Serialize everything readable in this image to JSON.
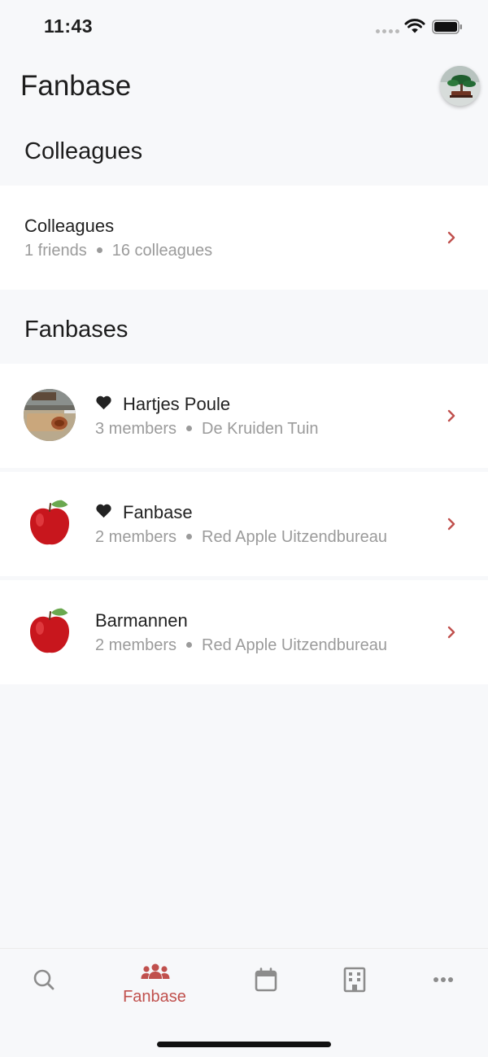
{
  "status_bar": {
    "time": "11:43"
  },
  "header": {
    "title": "Fanbase"
  },
  "colleagues_section": {
    "heading": "Colleagues",
    "item": {
      "title": "Colleagues",
      "friends": "1 friends",
      "colleagues": "16 colleagues"
    }
  },
  "fanbases_section": {
    "heading": "Fanbases",
    "items": [
      {
        "title": "Hartjes Poule",
        "members": "3 members",
        "organization": "De Kruiden Tuin",
        "favorite": true,
        "image": "kitchen-photo"
      },
      {
        "title": "Fanbase",
        "members": "2 members",
        "organization": "Red Apple Uitzendbureau",
        "favorite": true,
        "image": "red-apple-logo"
      },
      {
        "title": "Barmannen",
        "members": "2 members",
        "organization": "Red Apple Uitzendbureau",
        "favorite": false,
        "image": "red-apple-logo"
      }
    ]
  },
  "tab_bar": {
    "tabs": [
      {
        "icon": "search-icon",
        "label": ""
      },
      {
        "icon": "group-icon",
        "label": "Fanbase",
        "active": true
      },
      {
        "icon": "calendar-icon",
        "label": ""
      },
      {
        "icon": "building-icon",
        "label": ""
      },
      {
        "icon": "more-icon",
        "label": ""
      }
    ]
  },
  "colors": {
    "accent": "#c0504d",
    "background": "#f7f8fa",
    "row_background": "#ffffff",
    "secondary_text": "#9b9b9b"
  }
}
